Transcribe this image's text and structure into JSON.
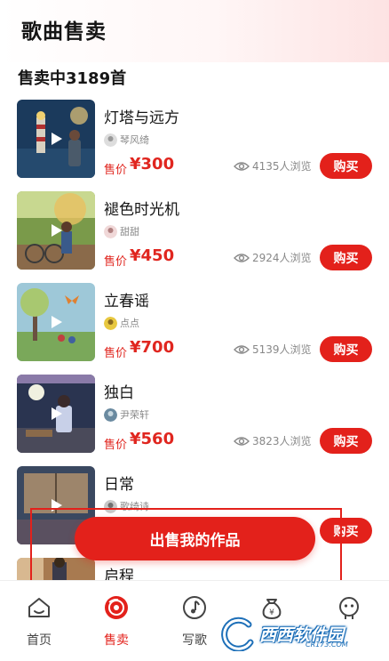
{
  "header": {
    "title": "歌曲售卖"
  },
  "section": {
    "title": "售卖中3189首"
  },
  "labels": {
    "price_label": "售价",
    "buy": "购买"
  },
  "songs": [
    {
      "title": "灯塔与远方",
      "author": "琴风绮",
      "price": "¥300",
      "views": "4135人浏览",
      "thumb_colors": [
        "#1b3a5c",
        "#c9a45a"
      ]
    },
    {
      "title": "褪色时光机",
      "author": "甜甜",
      "price": "¥450",
      "views": "2924人浏览",
      "thumb_colors": [
        "#6b8a3a",
        "#e0b860"
      ]
    },
    {
      "title": "立春谣",
      "author": "点点",
      "price": "¥700",
      "views": "5139人浏览",
      "thumb_colors": [
        "#7fb0c8",
        "#7aa85a"
      ]
    },
    {
      "title": "独白",
      "author": "尹荣轩",
      "price": "¥560",
      "views": "3823人浏览",
      "thumb_colors": [
        "#2a3450",
        "#8a7aa8"
      ]
    },
    {
      "title": "日常",
      "author": "歌绮诗",
      "price": "¥",
      "views": "",
      "thumb_colors": [
        "#3a4860",
        "#c8a070"
      ]
    },
    {
      "title": "启程",
      "author": "",
      "price": "",
      "views": "",
      "thumb_colors": [
        "#a87a50",
        "#d8b890"
      ]
    }
  ],
  "sell_button": {
    "label": "出售我的作品"
  },
  "tabs": [
    {
      "label": "首页",
      "icon": "home-icon"
    },
    {
      "label": "售卖",
      "icon": "record-icon",
      "active": true
    },
    {
      "label": "写歌",
      "icon": "music-note-icon"
    },
    {
      "label": "",
      "icon": "money-bag-icon"
    },
    {
      "label": "",
      "icon": "robot-icon"
    }
  ],
  "watermark": {
    "text": "西西软件园",
    "sub": "CR173.COM"
  },
  "colors": {
    "accent": "#e3211b",
    "muted": "#888888"
  }
}
